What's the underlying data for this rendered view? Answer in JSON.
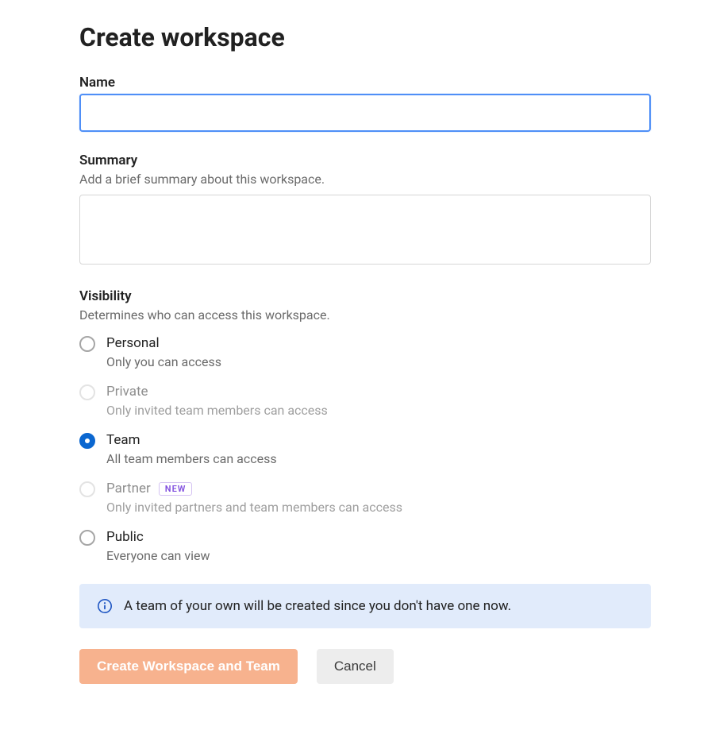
{
  "title": "Create workspace",
  "fields": {
    "name": {
      "label": "Name",
      "value": ""
    },
    "summary": {
      "label": "Summary",
      "help": "Add a brief summary about this workspace.",
      "value": ""
    },
    "visibility": {
      "label": "Visibility",
      "help": "Determines who can access this workspace.",
      "selected": "team",
      "options": {
        "personal": {
          "title": "Personal",
          "desc": "Only you can access",
          "disabled": false
        },
        "private": {
          "title": "Private",
          "desc": "Only invited team members can access",
          "disabled": true
        },
        "team": {
          "title": "Team",
          "desc": "All team members can access",
          "disabled": false
        },
        "partner": {
          "title": "Partner",
          "desc": "Only invited partners and team members can access",
          "disabled": true,
          "badge": "NEW"
        },
        "public": {
          "title": "Public",
          "desc": "Everyone can view",
          "disabled": false
        }
      }
    }
  },
  "banner": {
    "text": "A team of your own will be created since you don't have one now."
  },
  "buttons": {
    "primary": "Create Workspace and Team",
    "cancel": "Cancel"
  }
}
